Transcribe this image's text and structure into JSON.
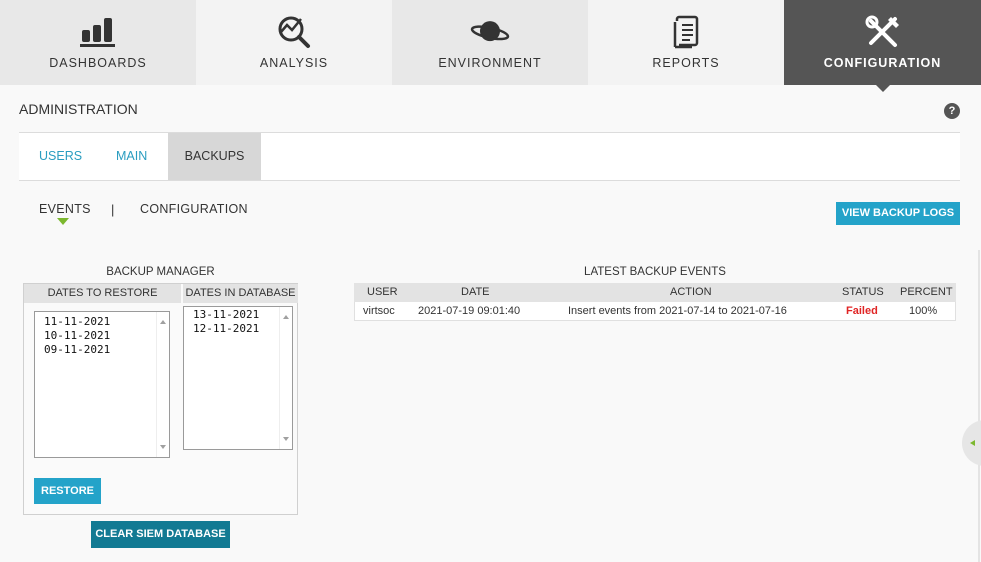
{
  "nav": {
    "tabs": [
      {
        "label": "DASHBOARDS",
        "icon": "bar-chart-icon"
      },
      {
        "label": "ANALYSIS",
        "icon": "magnifier-chart-icon"
      },
      {
        "label": "ENVIRONMENT",
        "icon": "planet-icon"
      },
      {
        "label": "REPORTS",
        "icon": "document-icon"
      },
      {
        "label": "CONFIGURATION",
        "icon": "tools-icon"
      }
    ],
    "active": "CONFIGURATION"
  },
  "admin": {
    "title": "ADMINISTRATION",
    "help": "?"
  },
  "subtabs": [
    {
      "label": "USERS"
    },
    {
      "label": "MAIN"
    },
    {
      "label": "BACKUPS"
    }
  ],
  "events_nav": {
    "events": "EVENTS",
    "separator": "|",
    "configuration": "CONFIGURATION"
  },
  "view_logs_label": "VIEW BACKUP LOGS",
  "backup_manager": {
    "title": "BACKUP MANAGER",
    "restore_header": "DATES TO RESTORE",
    "database_header": "DATES IN DATABASE",
    "dates_to_restore": [
      "11-11-2021",
      "10-11-2021",
      "09-11-2021"
    ],
    "dates_in_database": [
      "13-11-2021",
      "12-11-2021"
    ],
    "restore_label": "RESTORE",
    "clear_label": "CLEAR SIEM DATABASE"
  },
  "latest_events": {
    "title": "LATEST BACKUP EVENTS",
    "columns": [
      "USER",
      "DATE",
      "ACTION",
      "STATUS",
      "PERCENT"
    ],
    "rows": [
      {
        "user": "virtsoc",
        "date": "2021-07-19 09:01:40",
        "action": "Insert events from 2021-07-14 to 2021-07-16",
        "status": "Failed",
        "percent": "100%"
      }
    ]
  },
  "colors": {
    "accent": "#24a3c9",
    "accent_dark": "#127a93",
    "active_tab": "#555555",
    "failed": "#e02424",
    "indicator": "#7cb82f"
  }
}
